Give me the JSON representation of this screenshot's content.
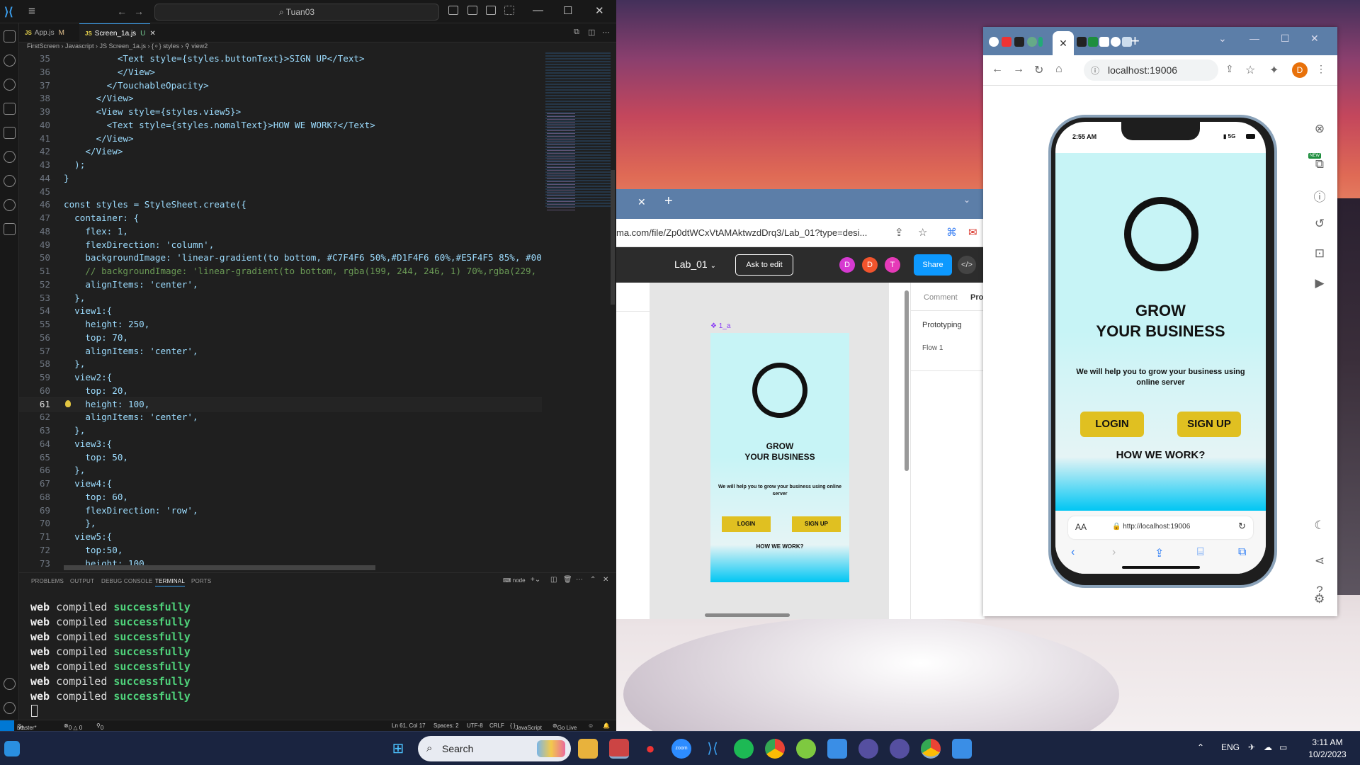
{
  "vscode": {
    "command_center": "Tuan03",
    "tabs": [
      {
        "name": "App.js",
        "status": "M"
      },
      {
        "name": "Screen_1a.js",
        "status": "U"
      }
    ],
    "breadcrumb": "FirstScreen  ›  Javascript  ›  JS Screen_1a.js  ›  {⚬} styles  ›  ⚲ view2",
    "code_lines": [
      {
        "num": "35",
        "text": "          <Text style={styles.buttonText}>SIGN UP</Text>"
      },
      {
        "num": "36",
        "text": "          </View>"
      },
      {
        "num": "37",
        "text": "        </TouchableOpacity>"
      },
      {
        "num": "38",
        "text": "      </View>"
      },
      {
        "num": "39",
        "text": "      <View style={styles.view5}>"
      },
      {
        "num": "40",
        "text": "        <Text style={styles.nomalText}>HOW WE WORK?</Text>"
      },
      {
        "num": "41",
        "text": "      </View>"
      },
      {
        "num": "42",
        "text": "    </View>"
      },
      {
        "num": "43",
        "text": "  );"
      },
      {
        "num": "44",
        "text": "}"
      },
      {
        "num": "45",
        "text": ""
      },
      {
        "num": "46",
        "text": "const styles = StyleSheet.create({"
      },
      {
        "num": "47",
        "text": "  container: {"
      },
      {
        "num": "48",
        "text": "    flex: 1,"
      },
      {
        "num": "49",
        "text": "    flexDirection: 'column',"
      },
      {
        "num": "50",
        "text": "    backgroundImage: 'linear-gradient(to bottom, #C7F4F6 50%,#D1F4F6 60%,#E5F4F5 85%, #00"
      },
      {
        "num": "51",
        "text": "    // backgroundImage: 'linear-gradient(to bottom, rgba(199, 244, 246, 1) 70%,rgba(229,"
      },
      {
        "num": "52",
        "text": "    alignItems: 'center',"
      },
      {
        "num": "53",
        "text": "  },"
      },
      {
        "num": "54",
        "text": "  view1:{"
      },
      {
        "num": "55",
        "text": "    height: 250,"
      },
      {
        "num": "56",
        "text": "    top: 70,"
      },
      {
        "num": "57",
        "text": "    alignItems: 'center',"
      },
      {
        "num": "58",
        "text": "  },"
      },
      {
        "num": "59",
        "text": "  view2:{"
      },
      {
        "num": "60",
        "text": "    top: 20,"
      },
      {
        "num": "61",
        "text": "    height: 100,"
      },
      {
        "num": "62",
        "text": "    alignItems: 'center',"
      },
      {
        "num": "63",
        "text": "  },"
      },
      {
        "num": "64",
        "text": "  view3:{"
      },
      {
        "num": "65",
        "text": "    top: 50,"
      },
      {
        "num": "66",
        "text": "  },"
      },
      {
        "num": "67",
        "text": "  view4:{"
      },
      {
        "num": "68",
        "text": "    top: 60,"
      },
      {
        "num": "69",
        "text": "    flexDirection: 'row',"
      },
      {
        "num": "70",
        "text": "    },"
      },
      {
        "num": "71",
        "text": "  view5:{"
      },
      {
        "num": "72",
        "text": "    top:50,"
      },
      {
        "num": "73",
        "text": "    height: 100,"
      }
    ],
    "current_line": "61",
    "panel_tabs": [
      "PROBLEMS",
      "OUTPUT",
      "DEBUG CONSOLE",
      "TERMINAL",
      "PORTS"
    ],
    "active_panel": "TERMINAL",
    "terminal_profile": "node",
    "terminal_word1": "web",
    "terminal_word2": "compiled",
    "terminal_word3": "successfully",
    "terminal_line_count": 7,
    "status": {
      "branch": "master*",
      "problems": "0 △ 0",
      "ports": "0",
      "cursor_pos": "Ln 61, Col 17",
      "spaces": "Spaces: 2",
      "encoding": "UTF-8",
      "eol": "CRLF",
      "language": "JavaScript",
      "golive": "Go Live"
    }
  },
  "figma": {
    "url": "ma.com/file/Zp0dtWCxVtAMAktwzdDrq3/Lab_01?type=desi...",
    "file_name": "Lab_01",
    "ask_to_edit": "Ask to edit",
    "avatars": [
      {
        "letter": "D",
        "color": "#d63ad1"
      },
      {
        "letter": "D",
        "color": "#f2542d"
      },
      {
        "letter": "T",
        "color": "#e63ab8"
      }
    ],
    "share": "Share",
    "frame_label": "1_a",
    "frame": {
      "title_line1": "GROW",
      "title_line2": "YOUR BUSINESS",
      "subtitle": "We will help you to grow your business using online server",
      "login": "LOGIN",
      "signup": "SIGN UP",
      "how": "HOW WE WORK?"
    },
    "right_tabs": [
      "Comment",
      "Pro"
    ],
    "prototyping": "Prototyping",
    "flow": "Flow 1"
  },
  "chrome": {
    "url": "localhost:19006",
    "profile": "D"
  },
  "phone": {
    "time": "2:55 AM",
    "signal": "5G",
    "title_line1": "GROW",
    "title_line2": "YOUR BUSINESS",
    "subtitle": "We will help you to grow your business using online server",
    "login": "LOGIN",
    "signup": "SIGN UP",
    "how": "HOW WE WORK?",
    "safari_aa": "AA",
    "safari_url": "http://localhost:19006"
  },
  "taskbar": {
    "search": "Search",
    "lang": "ENG",
    "time": "3:11 AM",
    "date": "10/2/2023"
  }
}
